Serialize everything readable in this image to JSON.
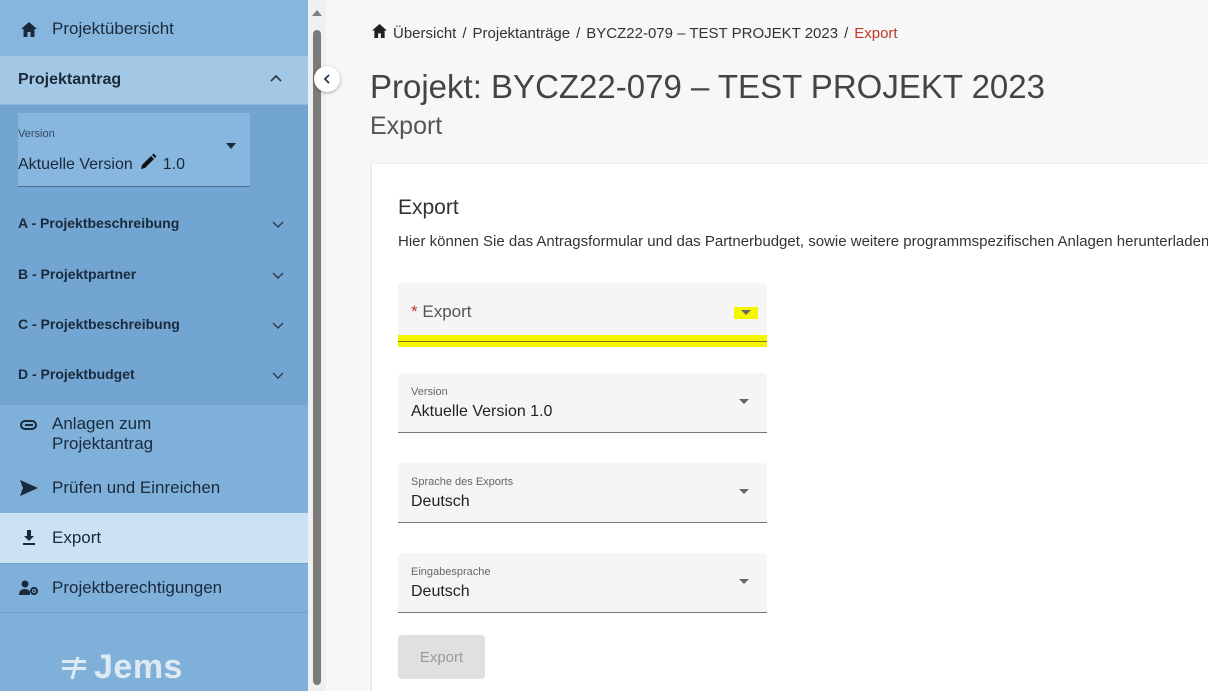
{
  "sidebar": {
    "overview_label": "Projektübersicht",
    "antrag_label": "Projektantrag",
    "version": {
      "label": "Version",
      "value": "Aktuelle Version",
      "number": "1.0"
    },
    "sections": [
      {
        "label": "A - Projektbeschreibung"
      },
      {
        "label": "B - Projektpartner"
      },
      {
        "label": "C - Projektbeschreibung"
      },
      {
        "label": "D - Projektbudget"
      }
    ],
    "anlagen_label_1": "Anlagen zum",
    "anlagen_label_2": "Projektantrag",
    "pruefen_label": "Prüfen und Einreichen",
    "export_label": "Export",
    "rechte_label": "Projektberechtigungen",
    "logo_text": "Jems"
  },
  "breadcrumb": {
    "items": [
      "Übersicht",
      "Projektanträge",
      "BYCZ22-079 – TEST PROJEKT 2023"
    ],
    "current": "Export",
    "separator": "/"
  },
  "header": {
    "title": "Projekt: BYCZ22-079 – TEST PROJEKT 2023",
    "subtitle": "Export"
  },
  "card": {
    "heading": "Export",
    "description": "Hier können Sie das Antragsformular und das Partnerbudget, sowie weitere programmspezifischen Anlagen herunterladen.",
    "export_field": {
      "required_mark": "*",
      "placeholder": "Export"
    },
    "version_field": {
      "label": "Version",
      "value": "Aktuelle Version 1.0"
    },
    "sprache_field": {
      "label": "Sprache des Exports",
      "value": "Deutsch"
    },
    "eingabe_field": {
      "label": "Eingabesprache",
      "value": "Deutsch"
    },
    "button_label": "Export"
  },
  "colors": {
    "sidebar_bg": "#7fb0d9",
    "active_item_bg": "#cbe2f5",
    "breadcrumb_current": "#c0392b",
    "highlight": "#f5f500"
  }
}
